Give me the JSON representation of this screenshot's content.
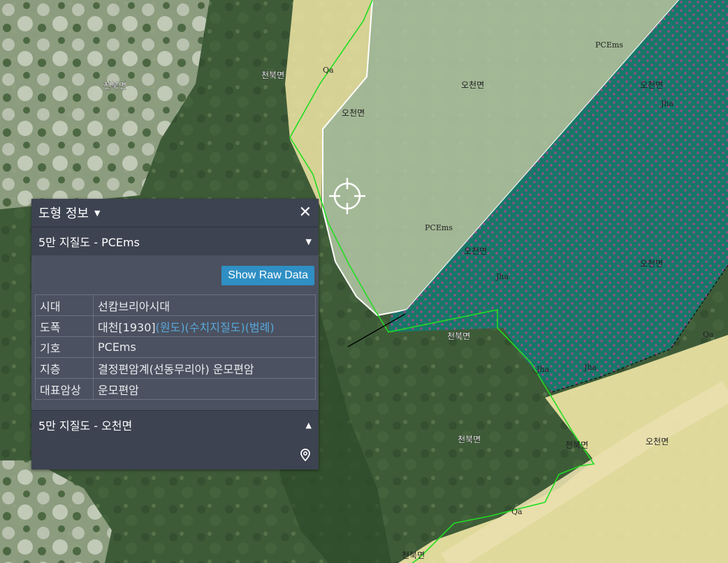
{
  "panel": {
    "title": "도형 정보",
    "close_icon": "close-icon",
    "layer1": {
      "name": "5만 지질도 - PCEms",
      "raw_button": "Show Raw Data",
      "rows": [
        {
          "key": "시대",
          "value": "선캄브리아시대"
        },
        {
          "key": "도폭",
          "value": "대천[1930]",
          "links": [
            "(원도)",
            "(수치지질도)",
            "(범례)"
          ]
        },
        {
          "key": "기호",
          "value": "PCEms"
        },
        {
          "key": "지층",
          "value": "결정편암계(선동무리아) 운모편암"
        },
        {
          "key": "대표암상",
          "value": "운모편암"
        }
      ]
    },
    "layer2": {
      "name": "5만 지질도 - 오천면",
      "pin_icon": "map-pin-icon"
    }
  },
  "map": {
    "admin_labels": {
      "cheonbuk": "천북면",
      "ocheon": "오천면"
    },
    "units": {
      "pcems": "PCEms",
      "jha": "Jha",
      "qa": "Qa"
    },
    "colors": {
      "qa_fill": "#f1e7a6",
      "pcems_fill": "#b4c8a6",
      "jha_fill": "#147a6c",
      "jha_dot": "#9a4c8c",
      "boundary_green": "#22dd22"
    },
    "crosshair_icon": "crosshair-icon"
  }
}
